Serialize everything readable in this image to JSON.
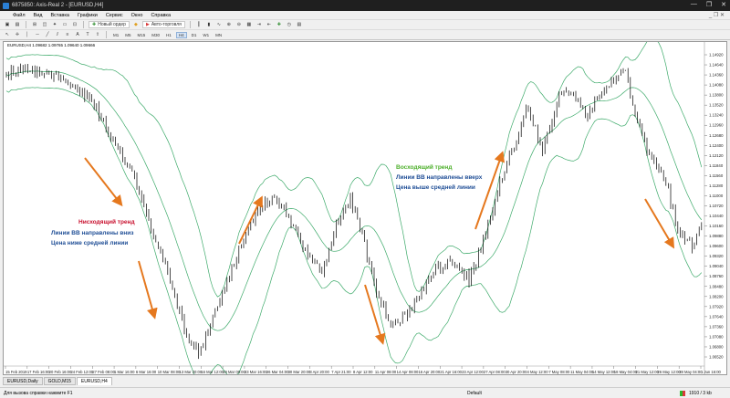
{
  "window": {
    "title": "6875850: Axis-Real 2 - [EURUSD,H4]",
    "controls": [
      "—",
      "❐",
      "✕"
    ]
  },
  "menu": {
    "items": [
      "Файл",
      "Вид",
      "Вставка",
      "Графики",
      "Сервис",
      "Окно",
      "Справка"
    ],
    "right": "_ ❐ ✕"
  },
  "toolbar": {
    "new_order": "Новый ордер",
    "autotrading": "Авто-торговля",
    "timeframes": [
      "M1",
      "M5",
      "M15",
      "M30",
      "H1",
      "H4",
      "D1",
      "W1",
      "MN"
    ]
  },
  "chart": {
    "header": "EURUSD,H4  1.09682 1.09765 1.09640 1.09666",
    "price_labels": [
      "1.14920",
      "1.14640",
      "1.14360",
      "1.14080",
      "1.13800",
      "1.13520",
      "1.13240",
      "1.12960",
      "1.12680",
      "1.12400",
      "1.12120",
      "1.11840",
      "1.11560",
      "1.11280",
      "1.11000",
      "1.10720",
      "1.10440",
      "1.10160",
      "1.09880",
      "1.09600",
      "1.09320",
      "1.09040",
      "1.08760",
      "1.08480",
      "1.08200",
      "1.07920",
      "1.07640",
      "1.07360",
      "1.07080",
      "1.06800",
      "1.06520"
    ],
    "time_labels": [
      "15 Feb 2019",
      "17 Feb 16:00",
      "20 Feb 16:00",
      "24 Feb 12:00",
      "27 Feb 08:00",
      "1 Mar 16:00",
      "6 Mar 16:00",
      "10 Mar 08:00",
      "13 Mar 20:00",
      "16 Mar 12:00",
      "19 Mar 08:00",
      "23 Mar 16:00",
      "26 Mar 04:00",
      "30 Mar 20:00",
      "3 Apr 20:00",
      "7 Apr 21:00",
      "8 Apr 12:00",
      "11 Apr 08:00",
      "14 Apr 08:00",
      "16 Apr 20:00",
      "21 Apr 16:00",
      "23 Apr 12:00",
      "27 Apr 08:00",
      "30 Apr 20:00",
      "4 May 12:00",
      "7 May 08:00",
      "11 May 04:00",
      "14 May 12:00",
      "18 May 04:00",
      "21 May 12:00",
      "26 May 12:00",
      "28 May 04:00",
      "1 Jun 16:00"
    ],
    "annotations": {
      "down_title": "Нисходящий тренд",
      "down_line1": "Линии BB направлены вниз",
      "down_line2": "Цена ниже средней линии",
      "up_title": "Восходящий тренд",
      "up_line1": "Линии BB направлены вверх",
      "up_line2": "Цена выше средней линии"
    },
    "colors": {
      "bands": "#3daa6a",
      "candles": "#000000",
      "arrows": "#e5781e",
      "down_title": "#c8102e",
      "up_title": "#4caf2a",
      "text_blue": "#1f4e96"
    }
  },
  "tabs": [
    "EURUSD,Daily",
    "GOLD,M15",
    "EURUSD,H4"
  ],
  "status": {
    "hint": "Для вызова справки нажмите F1",
    "profile": "Default",
    "traffic": "1910 / 3 kb"
  }
}
